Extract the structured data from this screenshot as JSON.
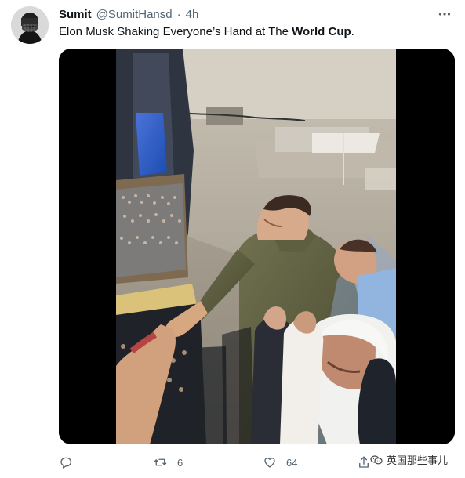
{
  "user": {
    "display_name": "Sumit",
    "handle": "@SumitHansd",
    "separator": "·",
    "time": "4h"
  },
  "tweet": {
    "text_prefix": "Elon Musk Shaking Everyone’s Hand at The ",
    "text_bold": "World Cup",
    "text_suffix": "."
  },
  "actions": {
    "reply_count": "",
    "retweet_count": "6",
    "like_count": "64"
  },
  "watermark": {
    "text": "英国那些事儿"
  },
  "colors": {
    "primary_text": "#0f1419",
    "secondary_text": "#536471",
    "media_background": "#000000"
  },
  "icons": {
    "more": "more-icon",
    "reply": "reply-icon",
    "retweet": "retweet-icon",
    "like": "heart-icon",
    "share": "share-icon"
  }
}
